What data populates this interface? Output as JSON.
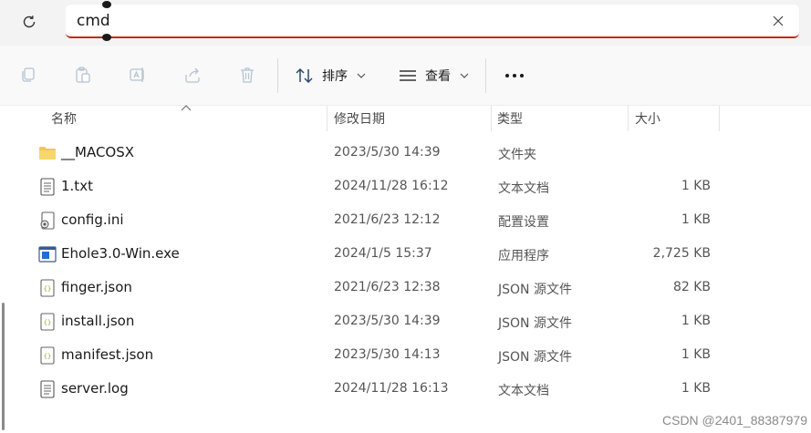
{
  "address_bar": {
    "value": "cmd"
  },
  "toolbar": {
    "sort_label": "排序",
    "view_label": "查看"
  },
  "columns": {
    "name": "名称",
    "date": "修改日期",
    "type": "类型",
    "size": "大小"
  },
  "files": [
    {
      "name": "__MACOSX",
      "date": "2023/5/30 14:39",
      "type": "文件夹",
      "size": "",
      "icon": "folder-icon"
    },
    {
      "name": "1.txt",
      "date": "2024/11/28 16:12",
      "type": "文本文档",
      "size": "1 KB",
      "icon": "text-file-icon"
    },
    {
      "name": "config.ini",
      "date": "2021/6/23 12:12",
      "type": "配置设置",
      "size": "1 KB",
      "icon": "config-file-icon"
    },
    {
      "name": "Ehole3.0-Win.exe",
      "date": "2024/1/5 15:37",
      "type": "应用程序",
      "size": "2,725 KB",
      "icon": "exe-file-icon"
    },
    {
      "name": "finger.json",
      "date": "2021/6/23 12:38",
      "type": "JSON 源文件",
      "size": "82 KB",
      "icon": "json-file-icon"
    },
    {
      "name": "install.json",
      "date": "2023/5/30 14:39",
      "type": "JSON 源文件",
      "size": "1 KB",
      "icon": "json-file-icon"
    },
    {
      "name": "manifest.json",
      "date": "2023/5/30 14:13",
      "type": "JSON 源文件",
      "size": "1 KB",
      "icon": "json-file-icon"
    },
    {
      "name": "server.log",
      "date": "2024/11/28 16:13",
      "type": "文本文档",
      "size": "1 KB",
      "icon": "text-file-icon"
    }
  ],
  "watermark": "CSDN @2401_88387979",
  "colors": {
    "accent_underline": "#c42b1c",
    "folder": "#f2c94c",
    "json_brace": "#8aa832"
  }
}
